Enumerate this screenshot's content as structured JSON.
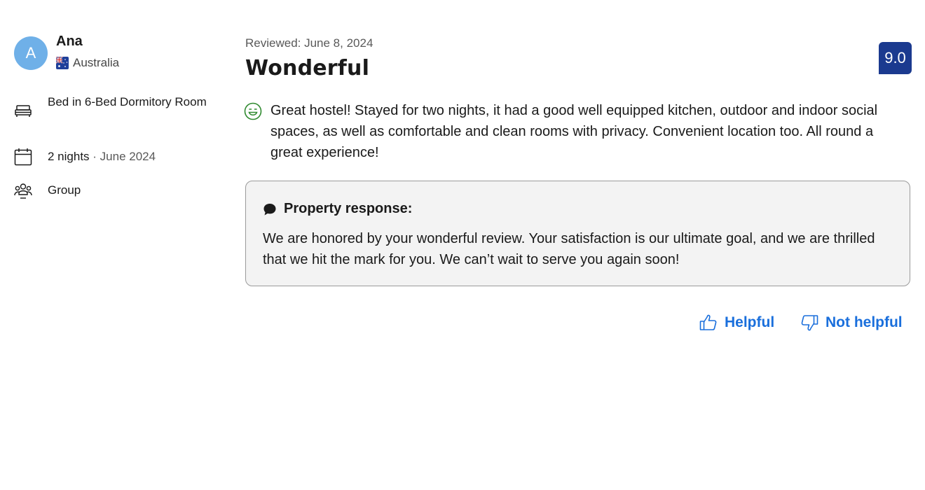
{
  "reviewer": {
    "initial": "A",
    "name": "Ana",
    "country": "Australia",
    "avatar_color": "#6fb0e8"
  },
  "stay_details": [
    {
      "icon": "bed-icon",
      "text": "Bed in 6-Bed Dormitory Room"
    },
    {
      "icon": "calendar-icon",
      "nights": "2 nights",
      "separator": " · ",
      "date": "June 2024"
    },
    {
      "icon": "group-icon",
      "text": "Group"
    }
  ],
  "review": {
    "reviewed_date": "Reviewed: June 8, 2024",
    "title": "Wonderful",
    "score": "9.0",
    "score_color": "#1b3a8f",
    "sentiment_icon": "smiley-face-icon",
    "text": "Great hostel! Stayed for two nights, it had a good well equipped kitchen, outdoor and indoor social spaces, as well as comfortable and clean rooms with privacy. Convenient location too. All round a great experience!"
  },
  "property_response": {
    "icon": "chat-bubble-icon",
    "title": "Property response:",
    "text": "We are honored by your wonderful review. Your satisfaction is our ultimate goal, and we are thrilled that we hit the mark for you. We can’t wait to serve you again soon!"
  },
  "actions": {
    "helpful_label": "Helpful",
    "not_helpful_label": "Not helpful",
    "link_color": "#1a6fdc"
  }
}
